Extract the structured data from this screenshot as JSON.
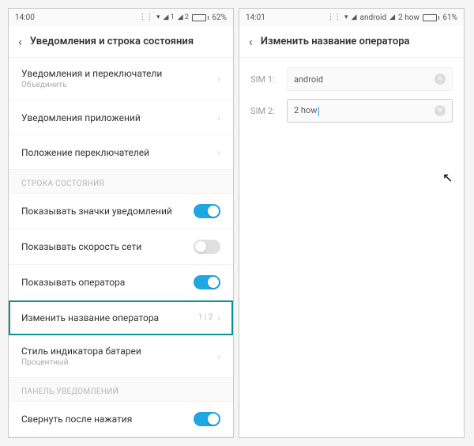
{
  "left": {
    "status": {
      "time": "14:00",
      "battery_pct": "62%",
      "battery_fill": 62
    },
    "title": "Уведомления и строка состояния",
    "rows": {
      "notif_toggle": {
        "label": "Уведомления и переключатели",
        "sub": "Объединить"
      },
      "app_notif": "Уведомления приложений",
      "toggle_pos": "Положение переключателей",
      "section_status": "СТРОКА СОСТОЯНИЯ",
      "show_icons": "Показывать значки уведомлений",
      "show_speed": "Показывать скорость сети",
      "show_operator": "Показывать оператора",
      "change_operator": {
        "label": "Изменить название оператора",
        "side": "1 | 2"
      },
      "battery_style": {
        "label": "Стиль индикатора батареи",
        "sub": "Процентный"
      },
      "section_panel": "ПАНЕЛЬ УВЕДОМЛЕНИЙ",
      "collapse_after_tap": "Свернуть после нажатия"
    }
  },
  "right": {
    "status": {
      "time": "14:01",
      "carrier1": "android",
      "carrier2": "2 how",
      "battery_pct": "61%",
      "battery_fill": 61
    },
    "title": "Изменить название оператора",
    "sim1": {
      "label": "SIM 1:",
      "value": "android"
    },
    "sim2": {
      "label": "SIM 2:",
      "value": "2 how"
    }
  }
}
